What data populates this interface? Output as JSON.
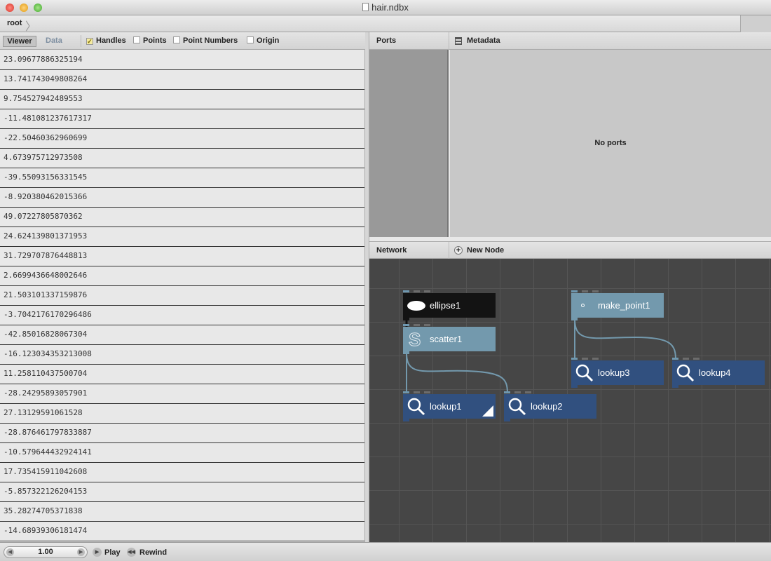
{
  "window": {
    "title": "hair.ndbx",
    "file_icon": "document-icon"
  },
  "breadcrumb": {
    "root": "root"
  },
  "viewer": {
    "tabs": [
      {
        "label": "Viewer",
        "active": true
      },
      {
        "label": "Data",
        "active": false
      }
    ],
    "options": [
      {
        "label": "Handles",
        "checked": true
      },
      {
        "label": "Points",
        "checked": false
      },
      {
        "label": "Point Numbers",
        "checked": false
      },
      {
        "label": "Origin",
        "checked": false
      }
    ],
    "values": [
      "23.09677886325194",
      "13.741743049808264",
      "9.754527942489553",
      "-11.481081237617317",
      "-22.50460362960699",
      "4.673975712973508",
      "-39.55093156331545",
      "-8.920380462015366",
      "49.07227805870362",
      "24.624139801371953",
      "31.729707876448813",
      "2.6699436648002646",
      "21.503101337159876",
      "-3.7042176170296486",
      "-42.85016828067304",
      "-16.123034353213008",
      "11.258110437500704",
      "-28.24295893057901",
      "27.13129591061528",
      "-28.876461797833887",
      "-10.579644432924141",
      "17.735415911042608",
      "-5.857322126204153",
      "35.28274705371838",
      "-14.68939306181474"
    ]
  },
  "ports": {
    "header": "Ports",
    "metadata_label": "Metadata",
    "empty": "No ports"
  },
  "network": {
    "header": "Network",
    "new_node": "New Node",
    "nodes": [
      {
        "name": "ellipse1",
        "icon": "ellipse-icon",
        "color": "#131313"
      },
      {
        "name": "scatter1",
        "icon": "scatter-icon",
        "color": "#7399ad"
      },
      {
        "name": "make_point1",
        "icon": "point-icon",
        "color": "#7399ad"
      },
      {
        "name": "lookup1",
        "icon": "magnifier-icon",
        "color": "#31507f",
        "rendered": true
      },
      {
        "name": "lookup2",
        "icon": "magnifier-icon",
        "color": "#31507f"
      },
      {
        "name": "lookup3",
        "icon": "magnifier-icon",
        "color": "#31507f"
      },
      {
        "name": "lookup4",
        "icon": "magnifier-icon",
        "color": "#31507f"
      }
    ]
  },
  "playback": {
    "frame": "1.00",
    "play": "Play",
    "rewind": "Rewind"
  }
}
